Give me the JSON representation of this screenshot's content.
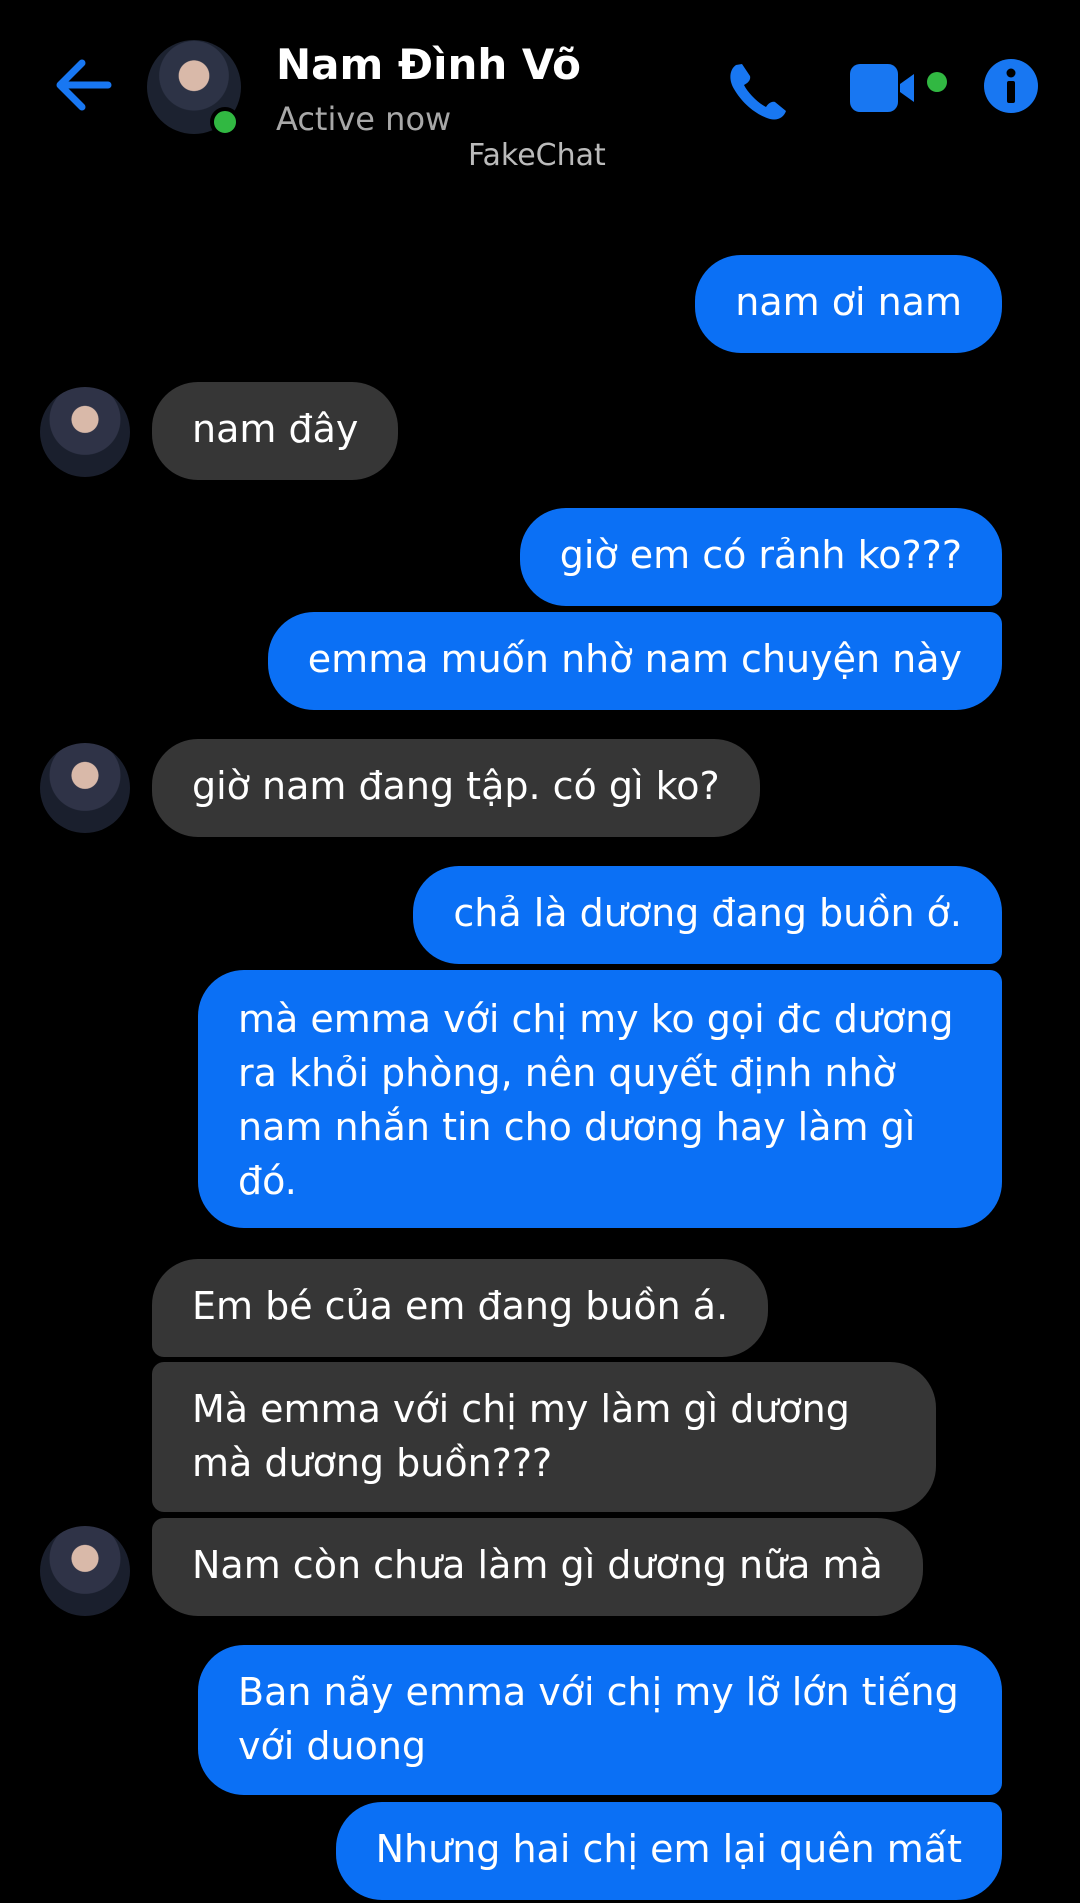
{
  "header": {
    "contact_name": "Nam Đình Võ",
    "status": "Active now",
    "watermark": "FakeChat",
    "icons": [
      "back-arrow-icon",
      "phone-icon",
      "video-icon",
      "info-icon"
    ],
    "accent_color": "#0b70f5",
    "online_color": "#31b842"
  },
  "messages": [
    {
      "side": "out",
      "text": "nam ơi nam"
    },
    {
      "side": "in",
      "text": "nam đây"
    },
    {
      "side": "out",
      "text": "giờ em có rảnh ko???"
    },
    {
      "side": "out",
      "text": "emma muốn nhờ nam chuyện này"
    },
    {
      "side": "in",
      "text": "giờ nam đang tập. có gì ko?"
    },
    {
      "side": "out",
      "text": "chả là dương đang buồn ớ."
    },
    {
      "side": "out",
      "text": "mà emma với chị my ko gọi đc dương ra khỏi phòng, nên quyết định nhờ nam nhắn tin cho dương hay làm gì đó."
    },
    {
      "side": "in",
      "text": "Em bé của em đang buồn á."
    },
    {
      "side": "in",
      "text": "Mà emma với chị my làm gì dương mà dương buồn???"
    },
    {
      "side": "in",
      "text": "Nam còn chưa làm gì dương nữa mà"
    },
    {
      "side": "out",
      "text": "Ban nãy emma với chị my lỡ lớn tiếng với duong"
    },
    {
      "side": "out",
      "text": "Nhưng hai chị em lại quên mất"
    }
  ]
}
